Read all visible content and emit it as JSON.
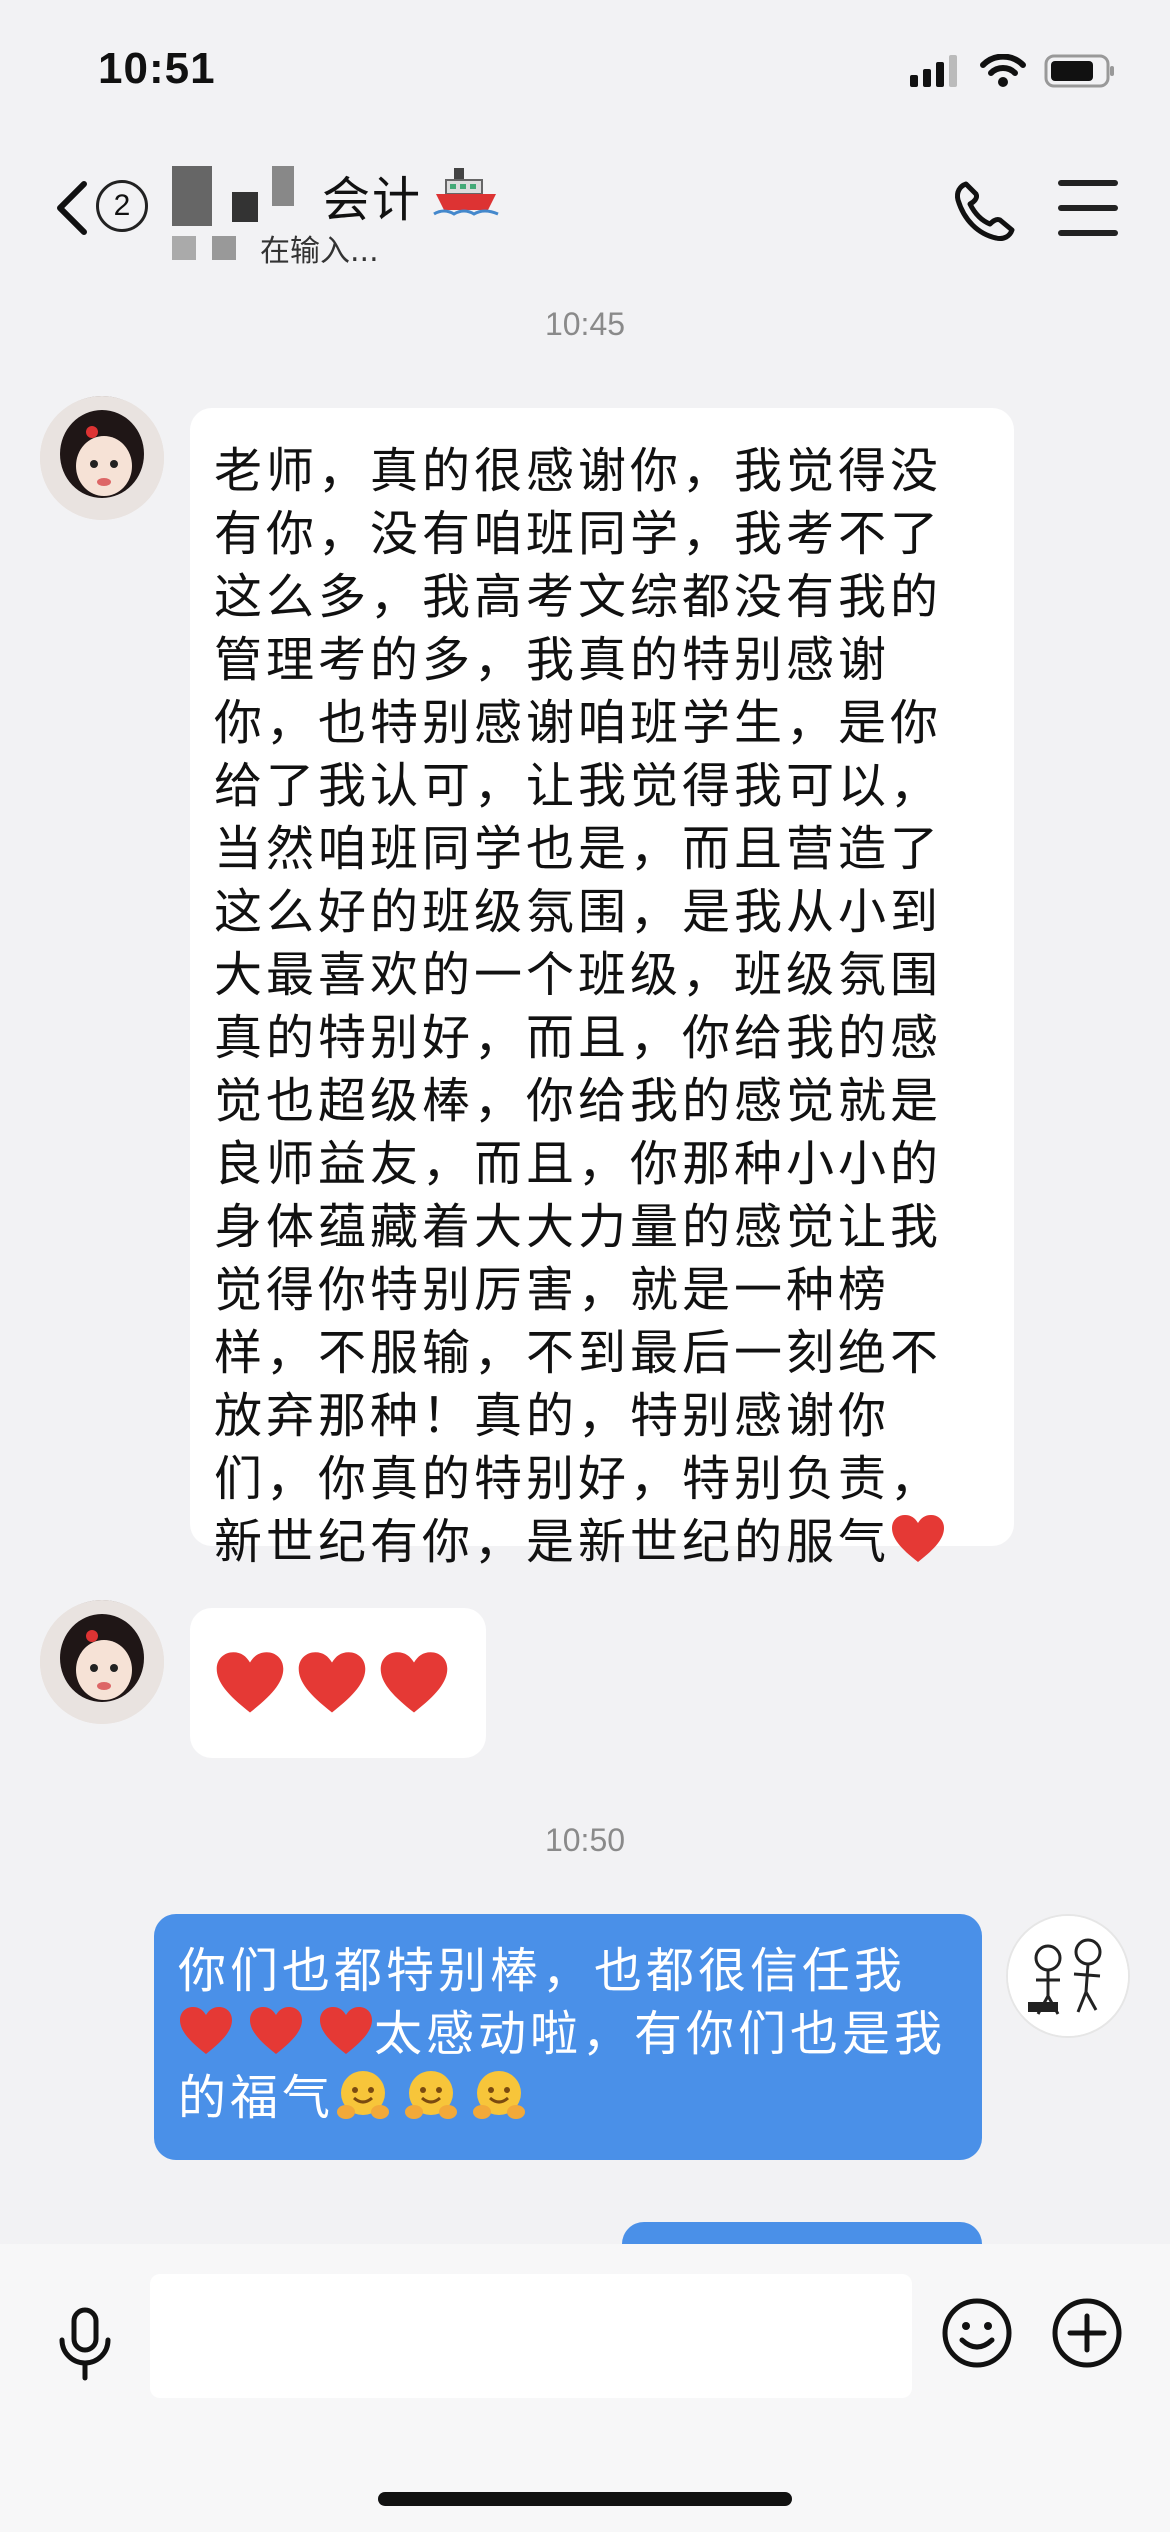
{
  "status_bar": {
    "time": "10:51",
    "icons": [
      "signal-icon",
      "wifi-icon",
      "battery-icon"
    ]
  },
  "header": {
    "unread_count": "2",
    "title": "会计",
    "status": "在输入...",
    "icons": [
      "chevron-left-icon",
      "ship-icon",
      "phone-icon",
      "menu-icon"
    ]
  },
  "messages": [
    {
      "type": "timestamp",
      "text": "10:45"
    },
    {
      "type": "incoming",
      "text": "老师，真的很感谢你，我觉得没有你，没有咱班同学，我考不了这么多，我高考文综都没有我的管理考的多，我真的特别感谢你，也特别感谢咱班学生，是你给了我认可，让我觉得我可以，当然咱班同学也是，而且营造了这么好的班级氛围，是我从小到大最喜欢的一个班级，班级氛围真的特别好，而且，你给我的感觉也超级棒，你给我的感觉就是良师益友，而且，你那种小小的身体蕴藏着大大力量的感觉让我觉得你特别厉害，就是一种榜样，不服输，不到最后一刻绝不放弃那种！真的，特别感谢你们，你真的特别好，特别负责，新世纪有你，是新世纪的服气",
      "emoji": "red-heart"
    },
    {
      "type": "incoming",
      "emoji": [
        "red-heart",
        "red-heart",
        "red-heart"
      ]
    },
    {
      "type": "timestamp",
      "text": "10:50"
    },
    {
      "type": "outgoing",
      "line1": "你们也都特别棒，也都很信任我",
      "line2": "太感动啦，有你们也是我",
      "line3": "的福气",
      "emoji_hearts": [
        "red-heart",
        "red-heart",
        "red-heart"
      ],
      "emoji_hugs": [
        "hugging-face",
        "hugging-face",
        "hugging-face"
      ]
    }
  ],
  "input_bar": {
    "placeholder": "",
    "icons": [
      "microphone-icon",
      "emoji-icon",
      "plus-icon"
    ]
  },
  "colors": {
    "background": "#f2f2f4",
    "outgoing_bubble": "#4a90e8",
    "incoming_bubble": "#ffffff",
    "heart": "#e53935"
  }
}
